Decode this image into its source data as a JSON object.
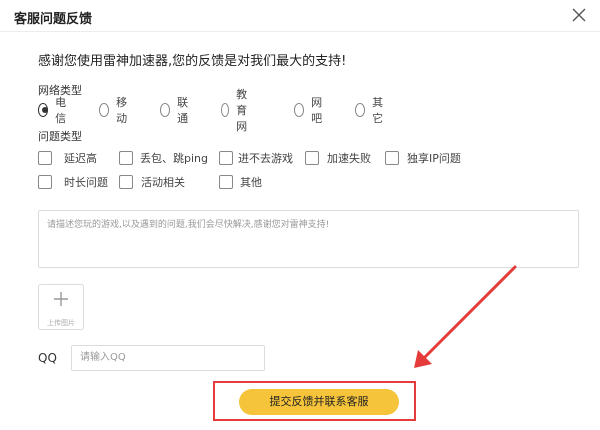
{
  "window": {
    "title": "客服问题反馈"
  },
  "intro_text": "感谢您使用雷神加速器,您的反馈是对我们最大的支持!",
  "network": {
    "label": "网络类型",
    "options": [
      "电信",
      "移动",
      "联通",
      "教育网",
      "网吧",
      "其它"
    ],
    "selected": "电信"
  },
  "issue": {
    "label": "问题类型",
    "options_row1": [
      "延迟高",
      "丢包、跳ping",
      "进不去游戏",
      "加速失败",
      "独享IP问题"
    ],
    "options_row2": [
      "时长问题",
      "活动相关",
      "其他"
    ]
  },
  "feedback": {
    "placeholder": "请描述您玩的游戏,以及遇到的问题,我们会尽快解决,感谢您对雷神支持!"
  },
  "upload": {
    "label": "上传图片"
  },
  "qq": {
    "label": "QQ",
    "placeholder": "请输入QQ"
  },
  "submit": {
    "label": "提交反馈并联系客服"
  },
  "colors": {
    "accent": "#f5c43a",
    "highlight": "#e53b3b"
  },
  "icons": {
    "close": "close-icon",
    "upload": "plus-icon",
    "annotation": "arrow-icon"
  }
}
